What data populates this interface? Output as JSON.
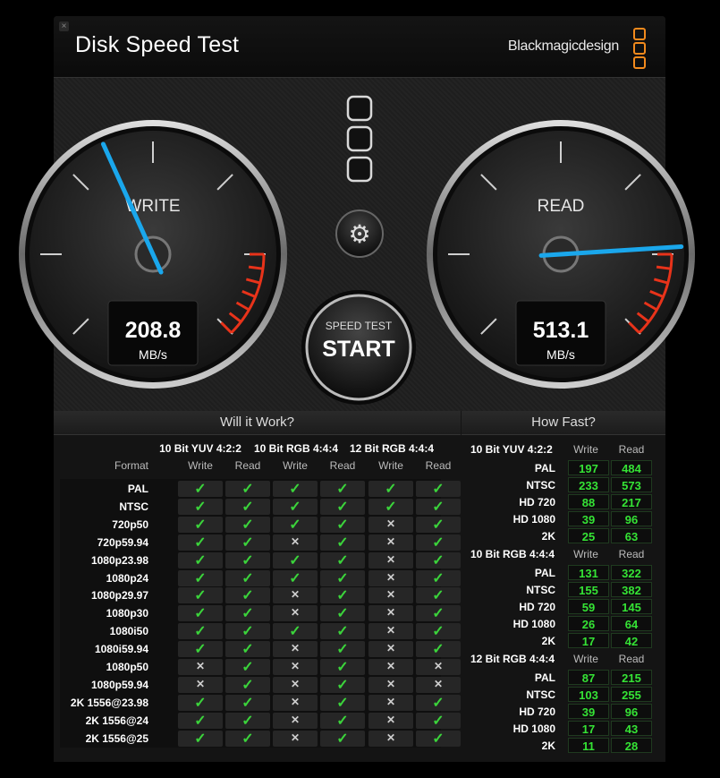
{
  "window": {
    "title": "Disk Speed Test",
    "brand": "Blackmagicdesign",
    "close_icon": "close-icon"
  },
  "gauges": {
    "write": {
      "label": "WRITE",
      "value": "208.8",
      "unit": "MB/s",
      "level": 0.41
    },
    "read": {
      "label": "READ",
      "value": "513.1",
      "unit": "MB/s",
      "level": 0.82
    }
  },
  "controls": {
    "speed_test_label": "SPEED TEST",
    "start_label": "START",
    "settings_icon": "gear-icon"
  },
  "will_it_work": {
    "title": "Will it Work?",
    "format_label": "Format",
    "groups": [
      "10 Bit YUV 4:2:2",
      "10 Bit RGB 4:4:4",
      "12 Bit RGB 4:4:4"
    ],
    "subheaders": [
      "Write",
      "Read"
    ],
    "rows": [
      {
        "name": "PAL",
        "cells": [
          1,
          1,
          1,
          1,
          1,
          1
        ]
      },
      {
        "name": "NTSC",
        "cells": [
          1,
          1,
          1,
          1,
          1,
          1
        ]
      },
      {
        "name": "720p50",
        "cells": [
          1,
          1,
          1,
          1,
          0,
          1
        ]
      },
      {
        "name": "720p59.94",
        "cells": [
          1,
          1,
          0,
          1,
          0,
          1
        ]
      },
      {
        "name": "1080p23.98",
        "cells": [
          1,
          1,
          1,
          1,
          0,
          1
        ]
      },
      {
        "name": "1080p24",
        "cells": [
          1,
          1,
          1,
          1,
          0,
          1
        ]
      },
      {
        "name": "1080p29.97",
        "cells": [
          1,
          1,
          0,
          1,
          0,
          1
        ]
      },
      {
        "name": "1080p30",
        "cells": [
          1,
          1,
          0,
          1,
          0,
          1
        ]
      },
      {
        "name": "1080i50",
        "cells": [
          1,
          1,
          1,
          1,
          0,
          1
        ]
      },
      {
        "name": "1080i59.94",
        "cells": [
          1,
          1,
          0,
          1,
          0,
          1
        ]
      },
      {
        "name": "1080p50",
        "cells": [
          0,
          1,
          0,
          1,
          0,
          0
        ]
      },
      {
        "name": "1080p59.94",
        "cells": [
          0,
          1,
          0,
          1,
          0,
          0
        ]
      },
      {
        "name": "2K 1556@23.98",
        "cells": [
          1,
          1,
          0,
          1,
          0,
          1
        ]
      },
      {
        "name": "2K 1556@24",
        "cells": [
          1,
          1,
          0,
          1,
          0,
          1
        ]
      },
      {
        "name": "2K 1556@25",
        "cells": [
          1,
          1,
          0,
          1,
          0,
          1
        ]
      }
    ]
  },
  "how_fast": {
    "title": "How Fast?",
    "write_label": "Write",
    "read_label": "Read",
    "groups": [
      {
        "name": "10 Bit YUV 4:2:2",
        "rows": [
          {
            "format": "PAL",
            "write": "197",
            "read": "484"
          },
          {
            "format": "NTSC",
            "write": "233",
            "read": "573"
          },
          {
            "format": "HD 720",
            "write": "88",
            "read": "217"
          },
          {
            "format": "HD 1080",
            "write": "39",
            "read": "96"
          },
          {
            "format": "2K",
            "write": "25",
            "read": "63"
          }
        ]
      },
      {
        "name": "10 Bit RGB 4:4:4",
        "rows": [
          {
            "format": "PAL",
            "write": "131",
            "read": "322"
          },
          {
            "format": "NTSC",
            "write": "155",
            "read": "382"
          },
          {
            "format": "HD 720",
            "write": "59",
            "read": "145"
          },
          {
            "format": "HD 1080",
            "write": "26",
            "read": "64"
          },
          {
            "format": "2K",
            "write": "17",
            "read": "42"
          }
        ]
      },
      {
        "name": "12 Bit RGB 4:4:4",
        "rows": [
          {
            "format": "PAL",
            "write": "87",
            "read": "215"
          },
          {
            "format": "NTSC",
            "write": "103",
            "read": "255"
          },
          {
            "format": "HD 720",
            "write": "39",
            "read": "96"
          },
          {
            "format": "HD 1080",
            "write": "17",
            "read": "43"
          },
          {
            "format": "2K",
            "write": "11",
            "read": "28"
          }
        ]
      }
    ]
  },
  "colors": {
    "needle": "#1aa7ec",
    "redzone": "#e8331a",
    "check": "#3bd43b",
    "logo": "#f28a1d"
  }
}
